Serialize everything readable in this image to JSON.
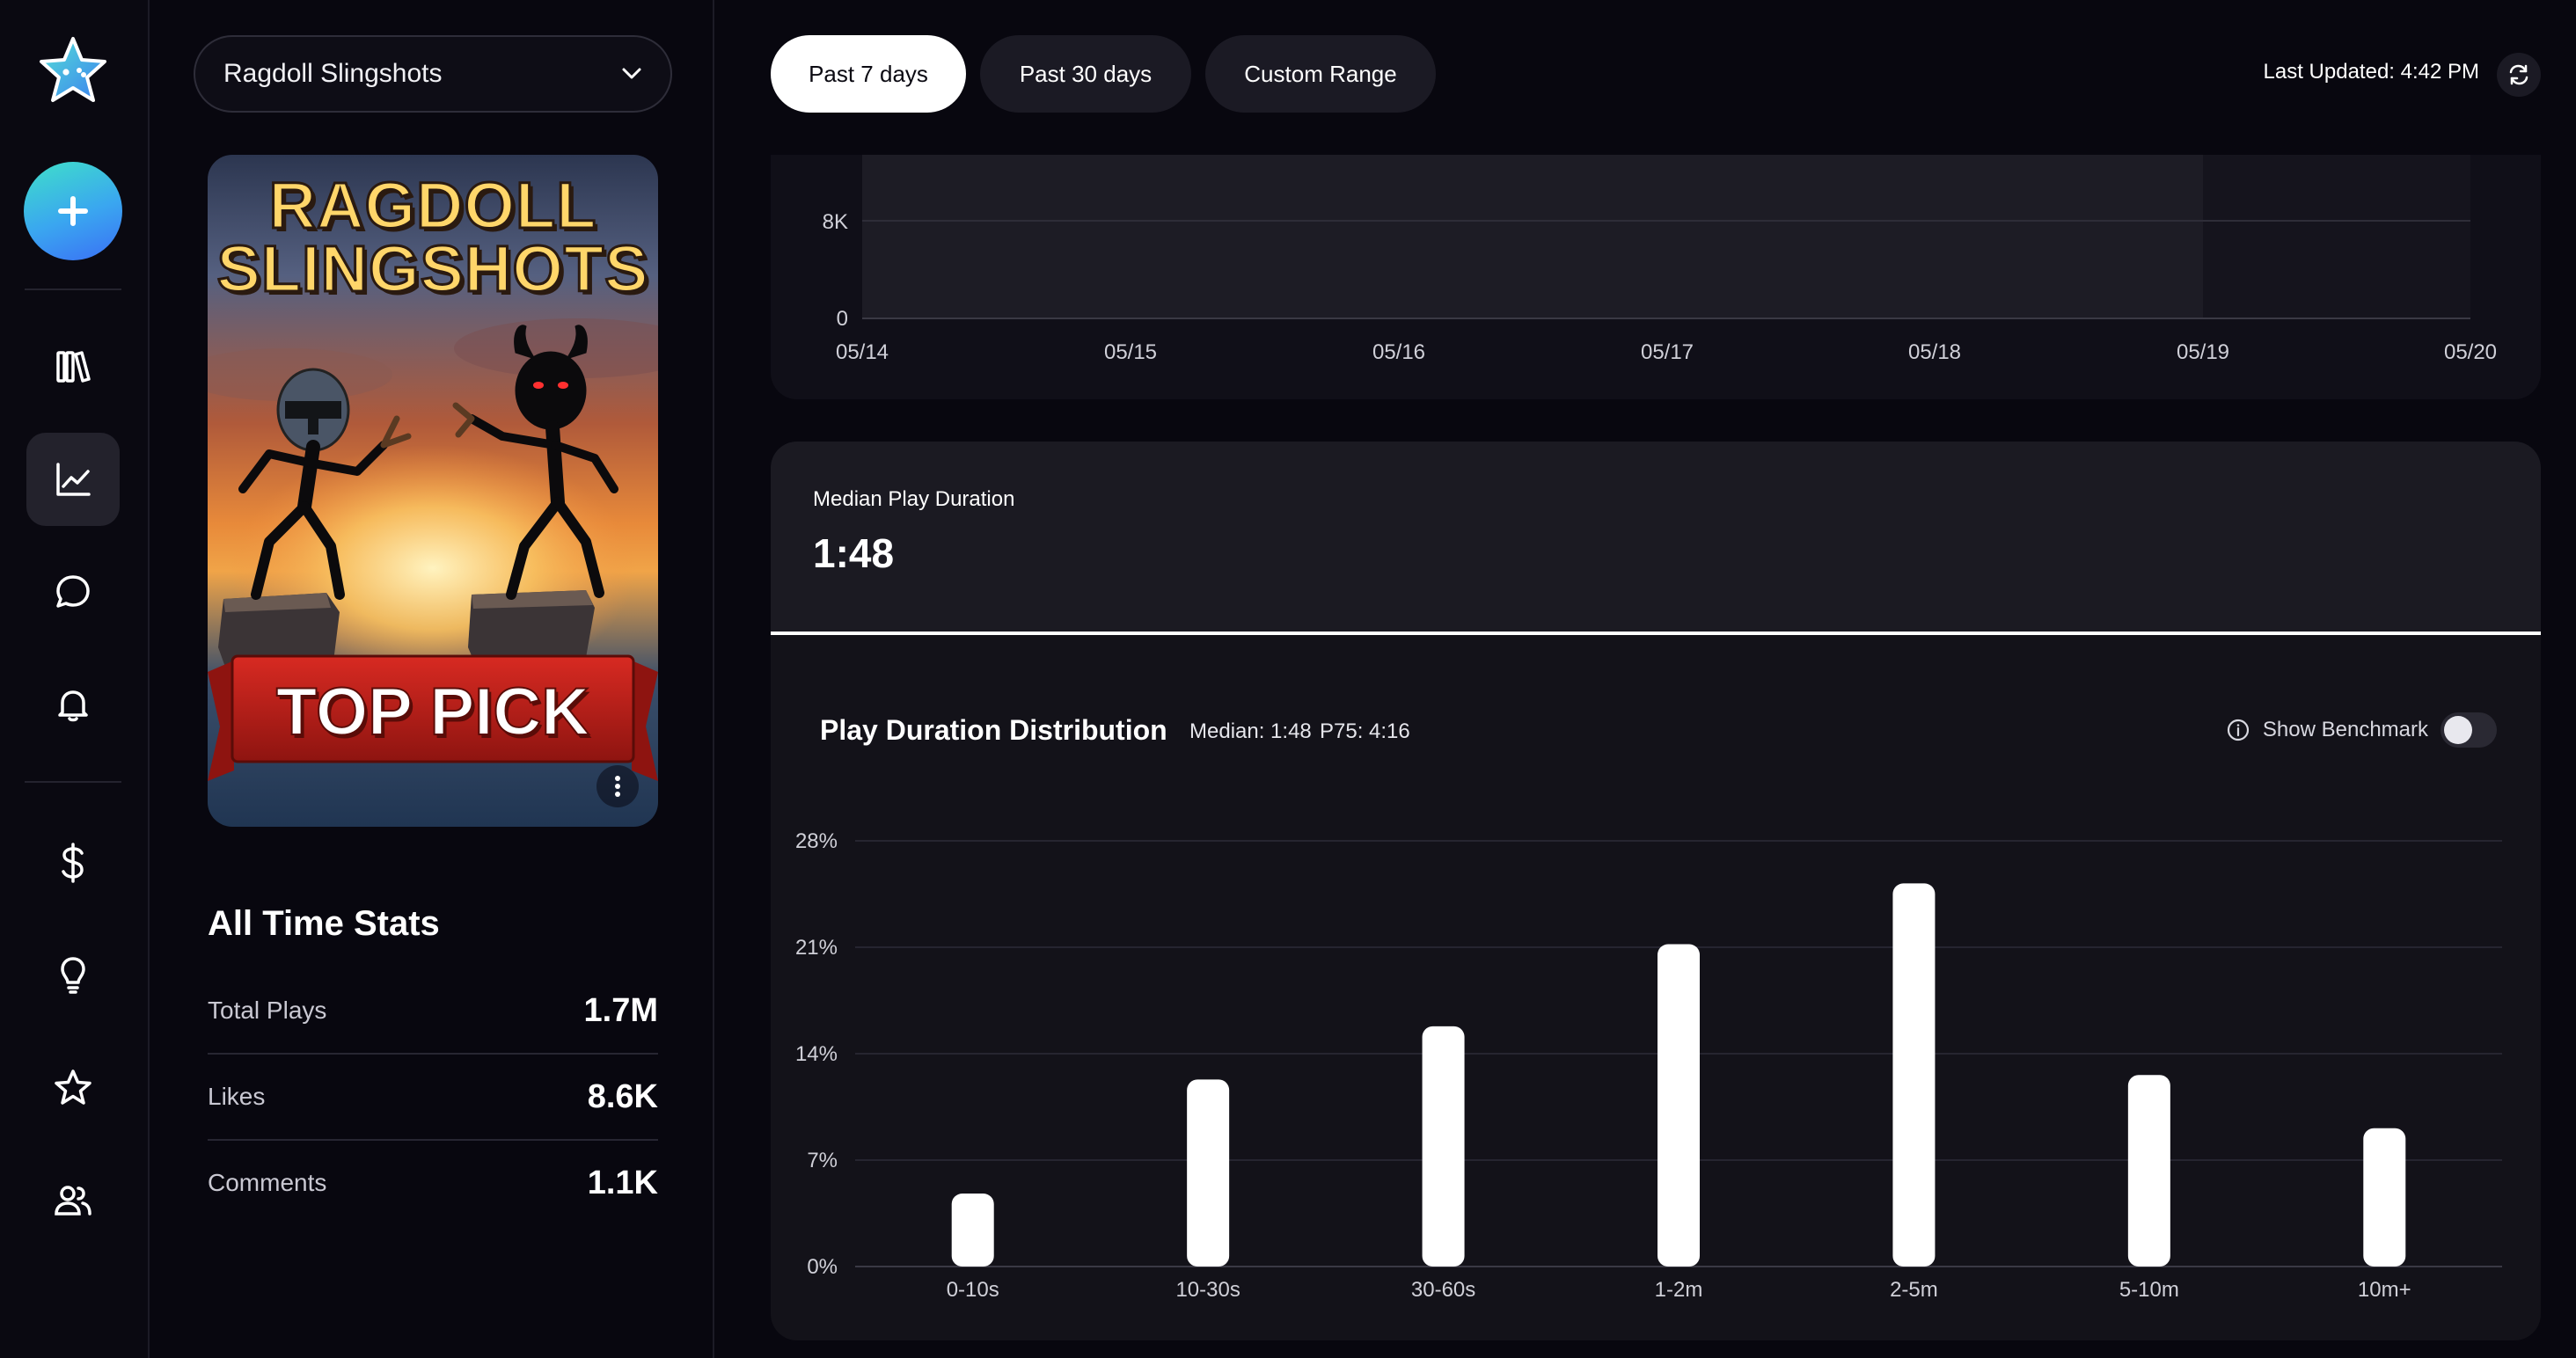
{
  "rail": {
    "items": [
      "library-icon",
      "analytics-icon",
      "chat-icon",
      "bell-icon",
      "dollar-icon",
      "lightbulb-icon",
      "star-icon",
      "users-icon"
    ],
    "active": "analytics-icon",
    "accent": "#3a8ff2"
  },
  "game": {
    "selected": "Ragdoll Slingshots",
    "cover_title_line1": "RAGDOLL",
    "cover_title_line2": "SLINGSHOTS",
    "cover_badge": "TOP PICK"
  },
  "all_time": {
    "title": "All Time Stats",
    "rows": [
      {
        "label": "Total Plays",
        "value": "1.7M"
      },
      {
        "label": "Likes",
        "value": "8.6K"
      },
      {
        "label": "Comments",
        "value": "1.1K"
      }
    ]
  },
  "range": {
    "options": [
      "Past 7 days",
      "Past 30 days",
      "Custom Range"
    ],
    "selected": "Past 7 days"
  },
  "last_updated": "Last Updated: 4:42 PM",
  "top_chart": {
    "y_ticks": [
      "8K",
      "0"
    ],
    "x_ticks": [
      "05/14",
      "05/15",
      "05/16",
      "05/17",
      "05/18",
      "05/19",
      "05/20"
    ]
  },
  "median_card": {
    "label": "Median Play Duration",
    "value": "1:48"
  },
  "distribution": {
    "title": "Play Duration Distribution",
    "median": "Median: 1:48",
    "p75": "P75: 4:16",
    "benchmark_label": "Show Benchmark",
    "benchmark_on": false
  },
  "chart_data": {
    "type": "bar",
    "title": "Play Duration Distribution",
    "categories": [
      "0-10s",
      "10-30s",
      "30-60s",
      "1-2m",
      "2-5m",
      "5-10m",
      "10m+"
    ],
    "values": [
      4.8,
      12.3,
      15.8,
      21.2,
      25.2,
      12.6,
      9.1
    ],
    "y_ticks": [
      "0%",
      "7%",
      "14%",
      "21%",
      "28%"
    ],
    "ylim": [
      0,
      28
    ],
    "grid": true,
    "bar_color": "#ffffff"
  }
}
